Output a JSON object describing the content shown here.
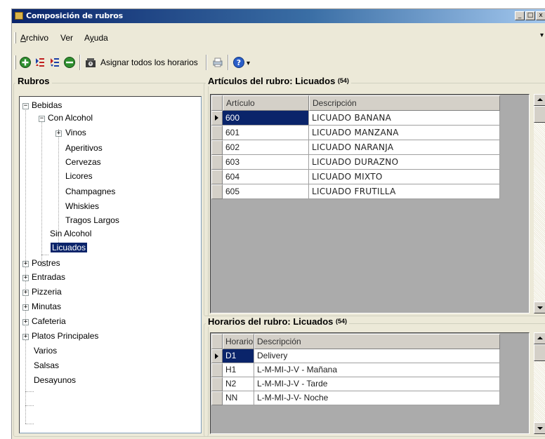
{
  "window": {
    "title": "Composición de rubros",
    "controls": {
      "minimize": "_",
      "maximize": "□",
      "close": "x"
    }
  },
  "menu": [
    {
      "label": "Archivo",
      "mnemonic": "A",
      "rest": "rchivo"
    },
    {
      "label": "Ver"
    },
    {
      "label": "Ayuda",
      "pre": "A",
      "mnemonic": "y",
      "rest": "uda"
    }
  ],
  "menu_overflow": "▾",
  "toolbar": {
    "buttons": [
      {
        "name": "add-icon",
        "color": "#2f8f2f"
      },
      {
        "name": "move-up-icon",
        "color": "#c02020"
      },
      {
        "name": "move-down-icon",
        "color": "#1a3fa8"
      },
      {
        "name": "remove-icon",
        "color": "#2f8f2f"
      },
      {
        "name": "schedule-icon"
      }
    ],
    "assign_label": "Asignar todos los horarios",
    "overflow": "▾"
  },
  "rubros": {
    "title": "Rubros",
    "tree": [
      {
        "label": "Bebidas",
        "expander": "−"
      },
      {
        "label": "Con Alcohol",
        "expander": "−"
      },
      {
        "label": "Vinos",
        "expander": "+"
      },
      {
        "label": "Aperitivos"
      },
      {
        "label": "Cervezas"
      },
      {
        "label": "Licores"
      },
      {
        "label": "Champagnes"
      },
      {
        "label": "Whiskies"
      },
      {
        "label": "Tragos Largos"
      },
      {
        "label": "Sin Alcohol"
      },
      {
        "label": "Licuados",
        "selected": true
      },
      {
        "label": "Postres",
        "expander": "+"
      },
      {
        "label": "Entradas",
        "expander": "+"
      },
      {
        "label": "Pizzeria",
        "expander": "+"
      },
      {
        "label": "Minutas",
        "expander": "+"
      },
      {
        "label": "Cafeteria",
        "expander": "+"
      },
      {
        "label": "Platos Principales",
        "expander": "+"
      },
      {
        "label": "Varios"
      },
      {
        "label": "Salsas"
      },
      {
        "label": "Desayunos"
      }
    ]
  },
  "articulos": {
    "title": "Artículos del rubro: Licuados",
    "count": "(54)",
    "columns": [
      "Artículo",
      "Descripción"
    ],
    "rows": [
      [
        "600",
        "LICUADO BANANA"
      ],
      [
        "601",
        "LICUADO MANZANA"
      ],
      [
        "602",
        "LICUADO NARANJA"
      ],
      [
        "603",
        "LICUADO DURAZNO"
      ],
      [
        "604",
        "LICUADO MIXTO"
      ],
      [
        "605",
        "LICUADO FRUTILLA"
      ]
    ]
  },
  "horarios": {
    "title": "Horarios del rubro: Licuados",
    "count": "(54)",
    "columns": [
      "Horario",
      "Descripción"
    ],
    "rows": [
      [
        "D1",
        "Delivery"
      ],
      [
        "H1",
        "L-M-MI-J-V - Mañana"
      ],
      [
        "N2",
        "L-M-MI-J-V - Tarde"
      ],
      [
        "NN",
        "L-M-MI-J-V- Noche"
      ]
    ]
  }
}
